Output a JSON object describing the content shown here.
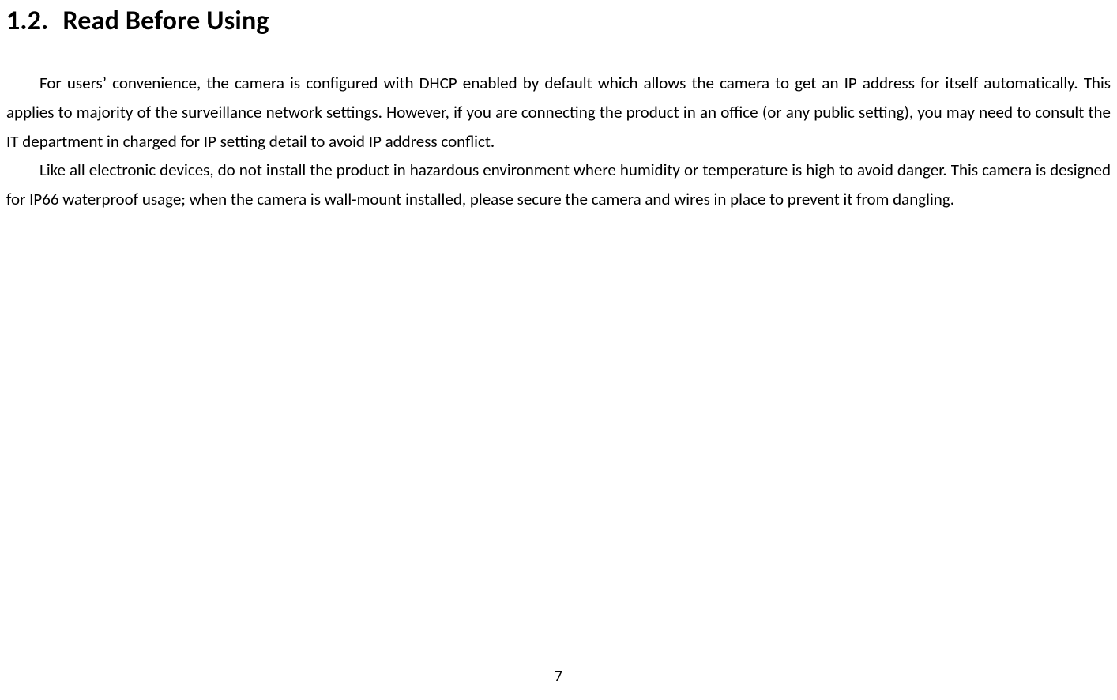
{
  "heading": {
    "number": "1.2.",
    "title": "Read Before Using"
  },
  "paragraphs": {
    "p1": "For users’ convenience, the camera is configured with DHCP enabled by default which allows the camera to get an IP address for itself automatically. This applies to majority of the surveillance network settings. However, if you are connecting the product in an office (or any public setting), you may need to consult the IT department in charged for IP setting detail to avoid IP address conflict.",
    "p2": "Like all electronic devices, do not install the product in hazardous environment where humidity or temperature is high to avoid danger. This camera is designed for IP66 waterproof usage; when the camera is wall-mount installed, please secure the camera and wires in place to prevent it from dangling."
  },
  "page_number": "7"
}
